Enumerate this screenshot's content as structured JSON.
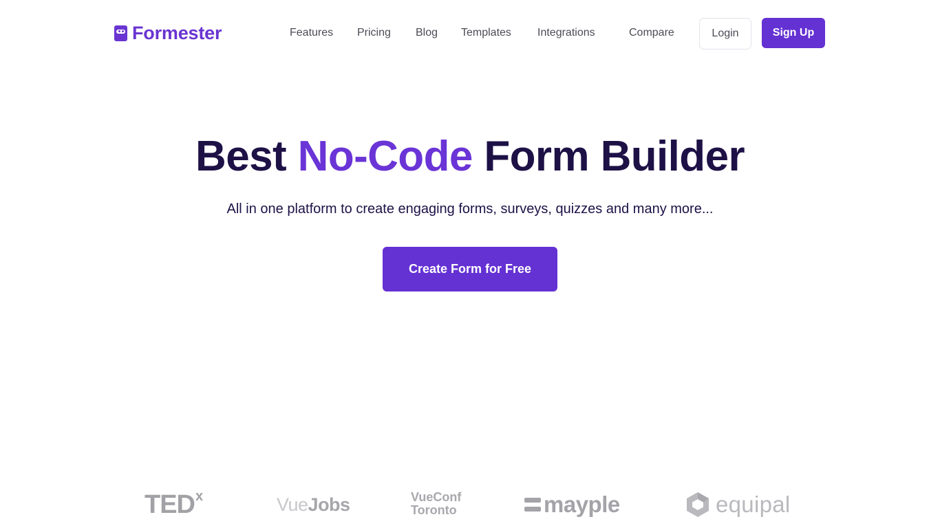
{
  "header": {
    "brand": "Formester",
    "nav": [
      {
        "label": "Features"
      },
      {
        "label": "Pricing"
      },
      {
        "label": "Blog"
      },
      {
        "label": "Templates"
      },
      {
        "label": "Integrations"
      },
      {
        "label": "Compare"
      }
    ],
    "login_label": "Login",
    "signup_label": "Sign Up"
  },
  "hero": {
    "title_before": "Best",
    "title_accent": "No-Code",
    "title_after": "Form Builder",
    "subtitle": "All in one platform to create engaging forms, surveys, quizzes and many more...",
    "cta_label": "Create Form for Free"
  },
  "logos": {
    "tedx": {
      "main": "TED",
      "super": "x"
    },
    "vuejobs": {
      "part1": "Vue",
      "part2": "Jobs"
    },
    "vueconf": {
      "line1": "VueConf",
      "line2": "Toronto"
    },
    "mayple": "mayple",
    "equipal": "equipal"
  },
  "colors": {
    "brand": "#6934d1",
    "primary_button": "#6431d3",
    "heading": "#1d1146",
    "accent_text": "#6a34d6",
    "logo_gray": "#a3a3a8"
  },
  "icons": {
    "brand_mark": "formester-logo-icon",
    "equipal_mark": "equipal-hexagon-icon",
    "mayple_mark": "mayple-bars-icon"
  }
}
